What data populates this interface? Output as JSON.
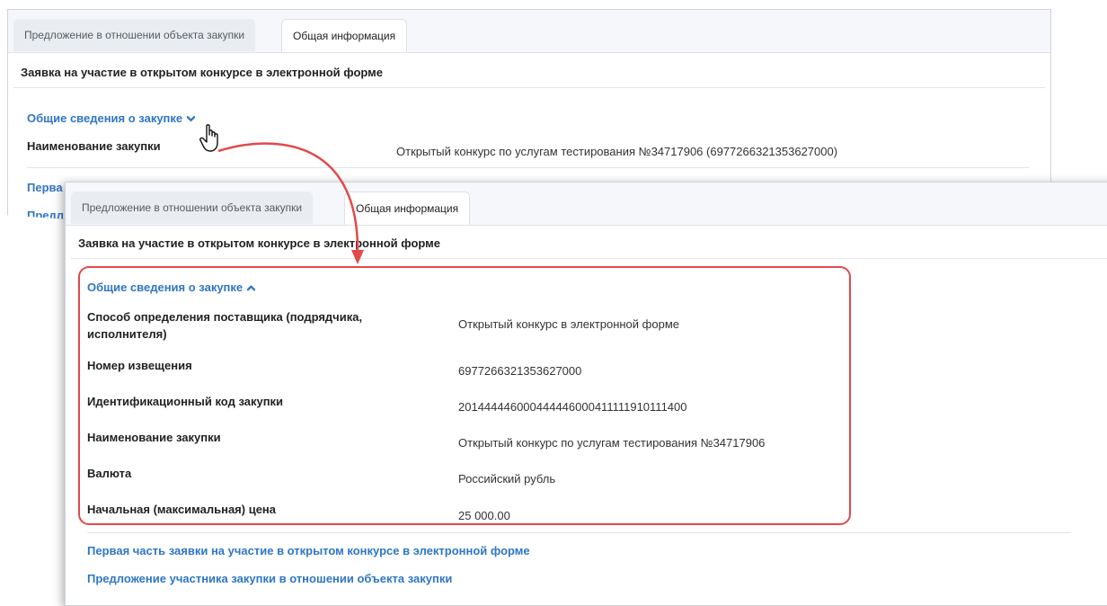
{
  "tabs": {
    "proposal": "Предложение в отношении объекта закупки",
    "general": "Общая информация"
  },
  "application_title": "Заявка на участие в открытом конкурсе в электронной форме",
  "back": {
    "section_link": "Общие сведения о закупке",
    "field_label": "Наименование закупки",
    "field_value": "Открытый конкурс по услугам тестирования №34717906 (6977266321353627000)",
    "partial_link_1": "Перва",
    "partial_link_2": "Предл"
  },
  "front": {
    "section_link": "Общие сведения о закупке",
    "fields": [
      {
        "label": "Способ определения поставщика (подрядчика, исполнителя)",
        "value": "Открытый конкурс в электронной форме"
      },
      {
        "label": "Номер извещения",
        "value": "6977266321353627000"
      },
      {
        "label": "Идентификационный код закупки",
        "value": "201444446000444446000411111910111400"
      },
      {
        "label": "Наименование закупки",
        "value": "Открытый конкурс по услугам тестирования №34717906"
      },
      {
        "label": "Валюта",
        "value": "Российский рубль"
      },
      {
        "label": "Начальная (максимальная) цена",
        "value": "25 000.00"
      }
    ],
    "links": [
      "Первая часть заявки на участие в открытом конкурсе в электронной форме",
      "Предложение участника закупки в отношении объекта закупки"
    ]
  },
  "colors": {
    "link": "#2f76c5",
    "highlight": "#e2494b"
  },
  "icons": [
    "chevron-down-icon",
    "chevron-up-icon",
    "hand-pointer-icon",
    "curved-arrow"
  ]
}
